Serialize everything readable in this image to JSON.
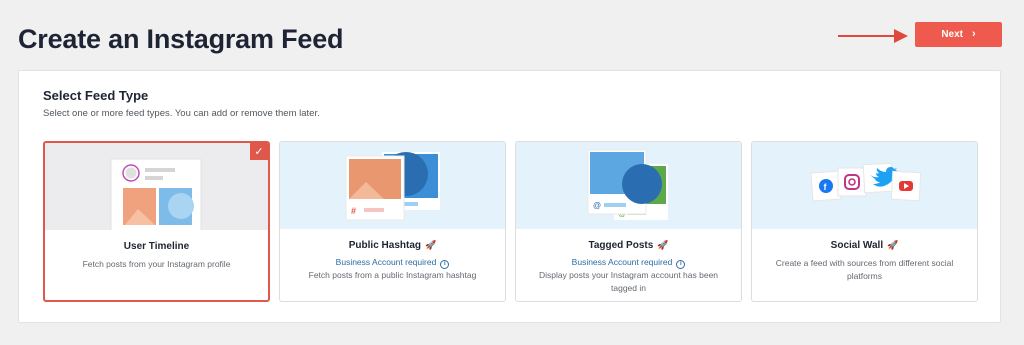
{
  "page": {
    "title": "Create an Instagram Feed"
  },
  "header": {
    "next_label": "Next",
    "next_icon": "chevron-right-icon"
  },
  "panel": {
    "title": "Select Feed Type",
    "subtitle": "Select one or more feed types. You can add or remove them later."
  },
  "cards": [
    {
      "title": "User Timeline",
      "requirement": "",
      "description": "Fetch posts from your Instagram profile",
      "selected": true
    },
    {
      "title": "Public Hashtag",
      "requirement": "Business Account required",
      "description": "Fetch posts from a public Instagram hashtag",
      "selected": false
    },
    {
      "title": "Tagged Posts",
      "requirement": "Business Account required",
      "description": "Display posts your Instagram account has been tagged in",
      "selected": false
    },
    {
      "title": "Social Wall",
      "requirement": "",
      "description": "Create a feed with sources from different social platforms",
      "selected": false
    }
  ],
  "colors": {
    "accent": "#ef5a4e",
    "link": "#2b6ca3",
    "thumb_bg": "#e4f3fb"
  }
}
